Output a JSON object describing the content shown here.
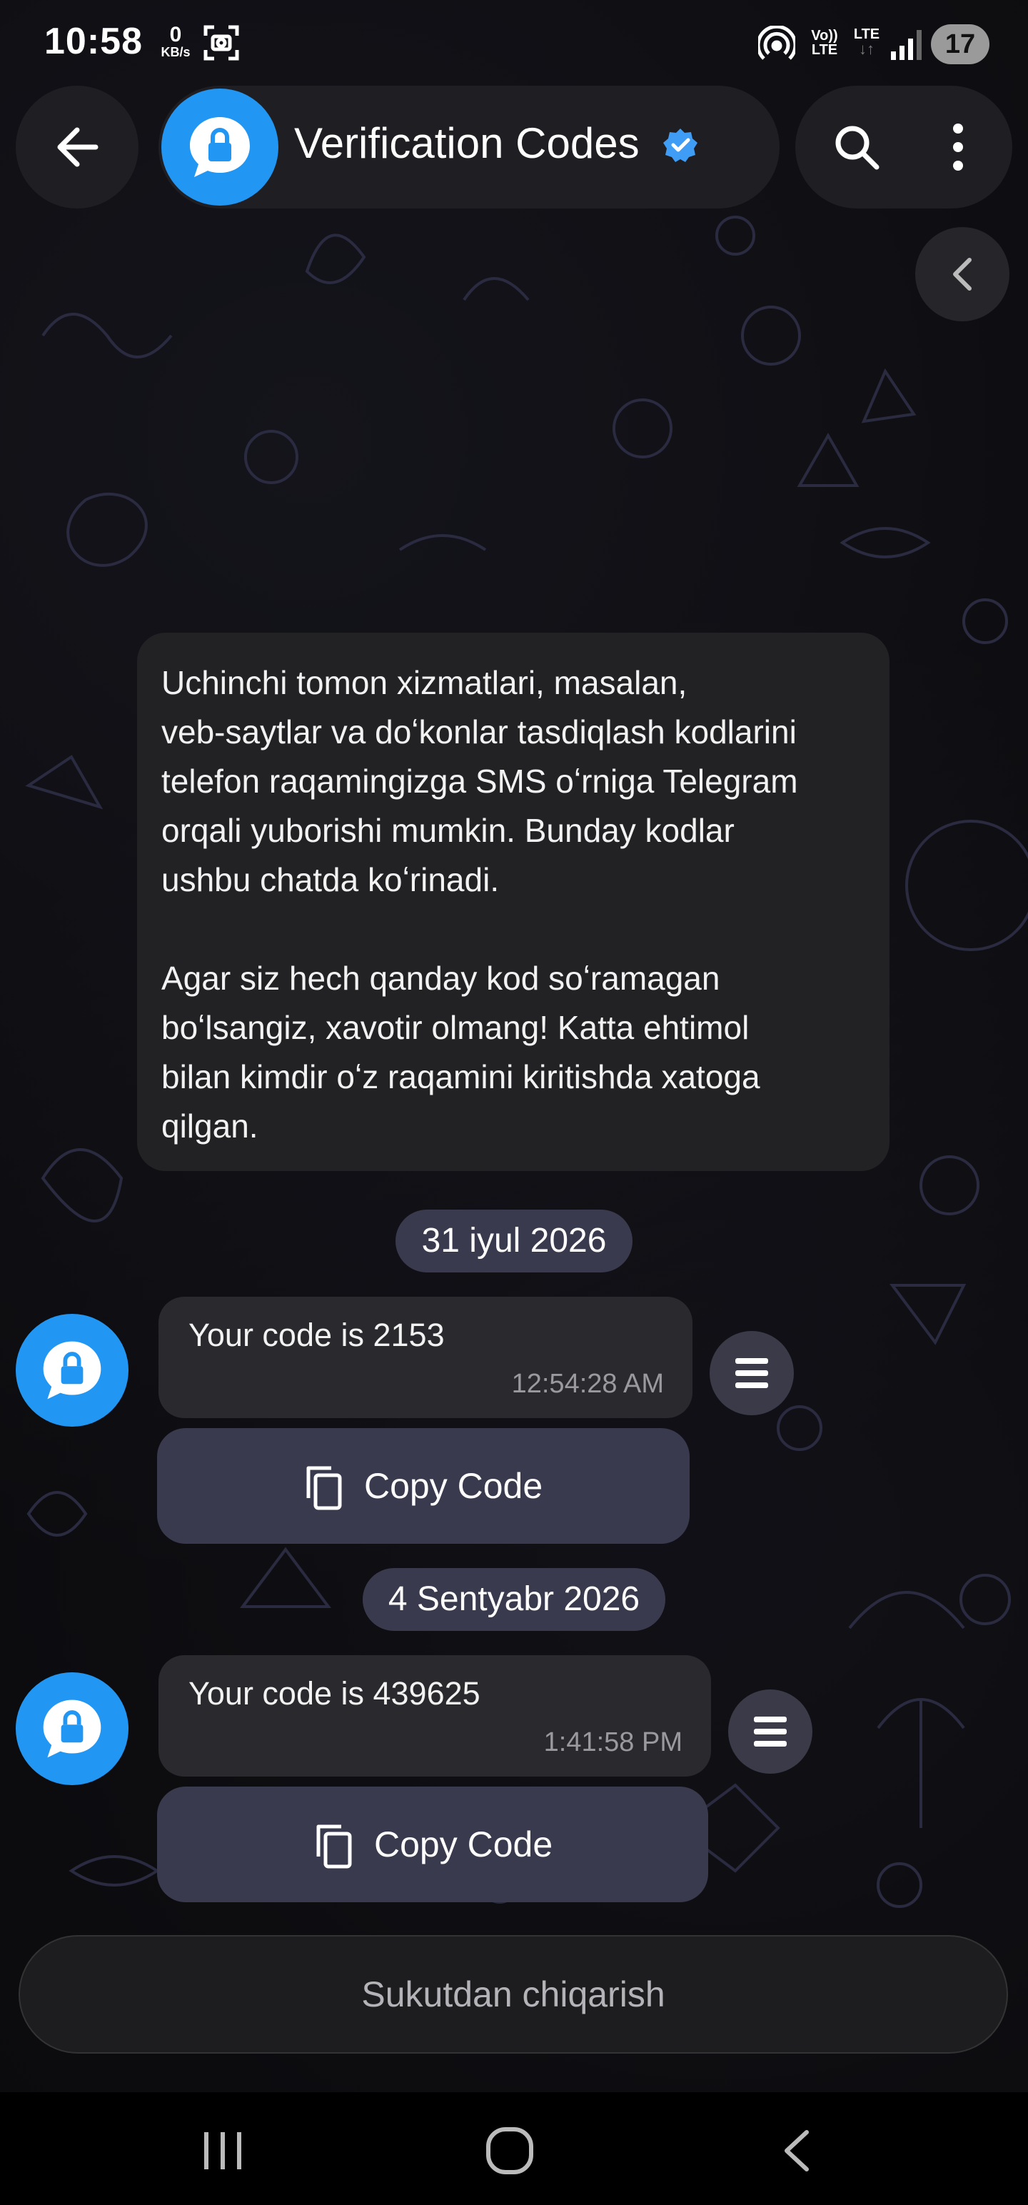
{
  "status_bar": {
    "time": "10:58",
    "net_speed_value": "0",
    "net_speed_unit": "KB/s",
    "volte_top": "Vo))",
    "volte_bottom": "LTE",
    "lte": "LTE",
    "battery": "17"
  },
  "header": {
    "title": "Verification Codes",
    "back_icon": "arrow-left-icon",
    "search_icon": "search-icon",
    "more_icon": "more-vertical-icon",
    "avatar_icon": "lock-chat-icon",
    "verified_icon": "verified-badge-icon"
  },
  "intro_message": {
    "text": "Uchinchi tomon xizmatlari, masalan,\nveb-saytlar va doʻkonlar tasdiqlash kodlarini\ntelefon raqamingizga SMS oʻrniga Telegram\norqali yuborishi mumkin. Bunday kodlar\nushbu chatda koʻrinadi.\n\nAgar siz hech qanday kod soʻramagan\nboʻlsangiz, xavotir olmang! Katta ehtimol\nbilan kimdir oʻz raqamini kiritishda xatoga\nqilgan."
  },
  "messages": [
    {
      "date": "31 iyul 2026",
      "text": "Your code is 2153",
      "time": "12:54:28 AM",
      "button": "Copy Code"
    },
    {
      "date": "4 Sentyabr 2026",
      "text": "Your code is 439625",
      "time": "1:41:58 PM",
      "button": "Copy Code"
    }
  ],
  "bottom": {
    "unmute_label": "Sukutdan chiqarish"
  },
  "colors": {
    "accent": "#2196f3",
    "bubble": "#222225",
    "button": "#393a4e"
  }
}
